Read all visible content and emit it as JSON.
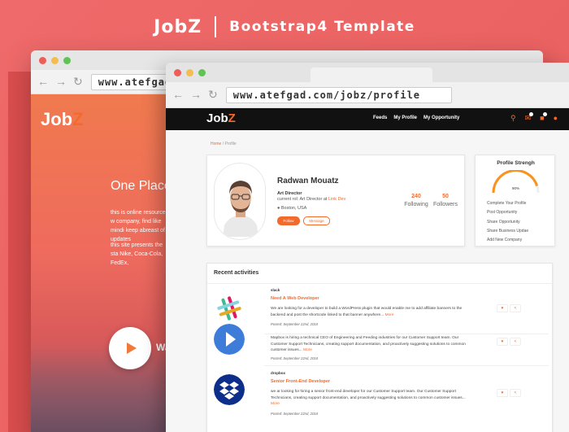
{
  "banner": {
    "logo": "JobZ",
    "subtitle": "Bootstrap4 Template"
  },
  "back_browser": {
    "url": "www.atefgad",
    "logo_main": "Job",
    "logo_accent": "Z",
    "hero_heading": "One Place,",
    "hero_p1": "this is online resource w company, find like mindi keep abreast of updates",
    "hero_p2": "this site presents the sta Nike, Coca-Cola, FedEx,",
    "video_label": "Wa"
  },
  "front_browser": {
    "url": "www.atefgad.com/jobz/profile",
    "nav": {
      "logo_main": "Job",
      "logo_accent": "Z",
      "links": [
        "Feeds",
        "My Profile",
        "My Opportunity"
      ]
    },
    "breadcrumb": {
      "home": "Home",
      "separator": "/",
      "current": "Profile"
    },
    "profile": {
      "name": "Radwan Mouatz",
      "role": "Art Director",
      "current_prefix": "current rol: Art Director at",
      "current_company": "Link Dev",
      "location": "Boston, USA",
      "follow_label": "Follow",
      "message_label": "Message",
      "following_count": "240",
      "following_label": "Following",
      "followers_count": "50",
      "followers_label": "Followers"
    },
    "strength": {
      "title": "Profile Strengh",
      "percent_text": "90%",
      "percent_value": 0.9,
      "items": [
        "Complete Your Profile",
        "Post Opportunity",
        "Share Opportunity",
        "Share Business Updae",
        "Add New Company"
      ]
    },
    "activities": {
      "title": "Recent activities",
      "items": [
        {
          "company": "slack",
          "job": "Need A Web Developer",
          "desc": "We are looking for a developer to build a WordPress plugin that would enable me to add affiliate banners to the backend and post the shortcode linked to that banner anywhere...",
          "more": "More",
          "posted": "Posted: September 22nd, 2018"
        },
        {
          "company": "",
          "job": "",
          "desc": "Mapbox is hiring a technical CEO of Engineering and Feeding industries for our Customer Support team. Our Customer Support Technicians, creating support documentation, and proactively suggesting solutions to common customer issues...",
          "more": "More",
          "posted": "Posted: September 22nd, 2018"
        },
        {
          "company": "dropbox",
          "job": "Senior Front-End Developer",
          "desc": "we ar looking for hiring a senior front-end developer for our Customer Support team. Our Customer Support Technicians, creating support documentation, and proactively suggesting solutions to common customer issues...",
          "more": "More",
          "posted": "Posted: September 22nd, 2018"
        }
      ]
    }
  },
  "colors": {
    "background": "#ef6a6a",
    "accent": "#f26b2c",
    "nav_bg": "#111111",
    "slack_bg": "#ffffff",
    "mapbox": "#3e7cd9",
    "dropbox": "#0d2f8b"
  }
}
